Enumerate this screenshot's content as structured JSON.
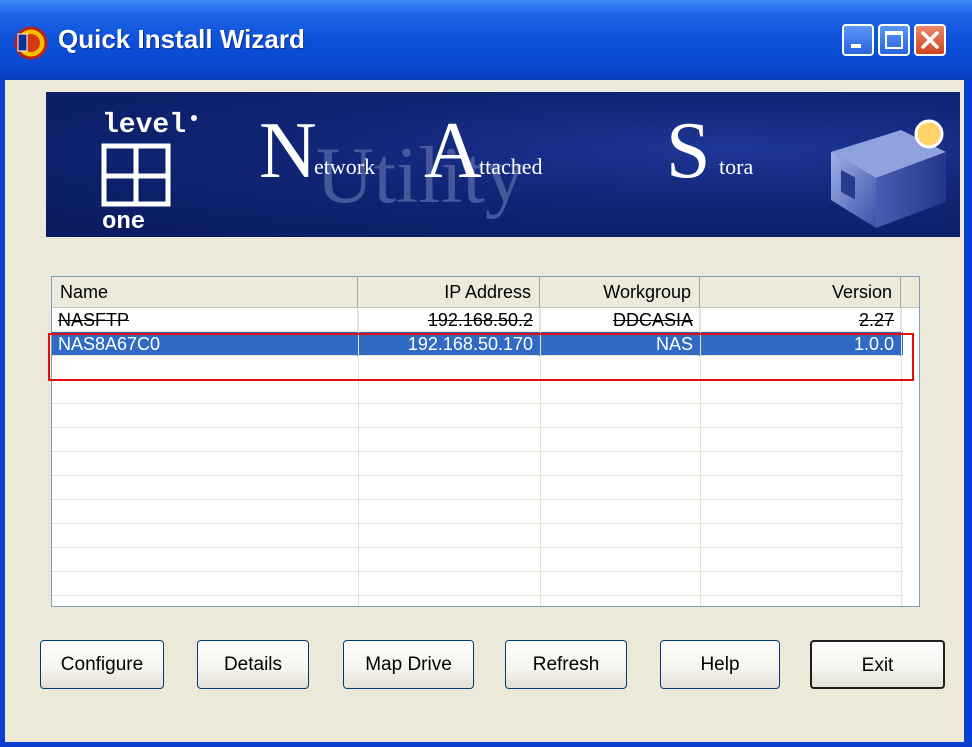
{
  "window": {
    "title": "Quick Install Wizard"
  },
  "banner": {
    "logo_top": "level",
    "logo_bottom": "one",
    "big_letters": [
      "N",
      "A",
      "S"
    ],
    "word_fragments": [
      "etwork",
      "ttached",
      "tora"
    ],
    "watermark": "Utility"
  },
  "listview": {
    "columns": [
      "Name",
      "IP Address",
      "Workgroup",
      "Version"
    ],
    "rows": [
      {
        "name": "NASFTP",
        "ip": "192.168.50.2",
        "workgroup": "DDCASIA",
        "version": "2.27"
      },
      {
        "name": "NAS8A67C0",
        "ip": "192.168.50.170",
        "workgroup": "NAS",
        "version": "1.0.0"
      }
    ],
    "selected_row": "NAS8A67C0"
  },
  "buttons": {
    "configure": "Configure",
    "details": "Details",
    "map_drive": "Map Drive",
    "refresh": "Refresh",
    "help": "Help",
    "exit": "Exit"
  },
  "colors": {
    "titlebar": "#0a48cf",
    "selection": "#316ac5",
    "highlight_box": "#e01010",
    "banner_bg": "#102576"
  }
}
